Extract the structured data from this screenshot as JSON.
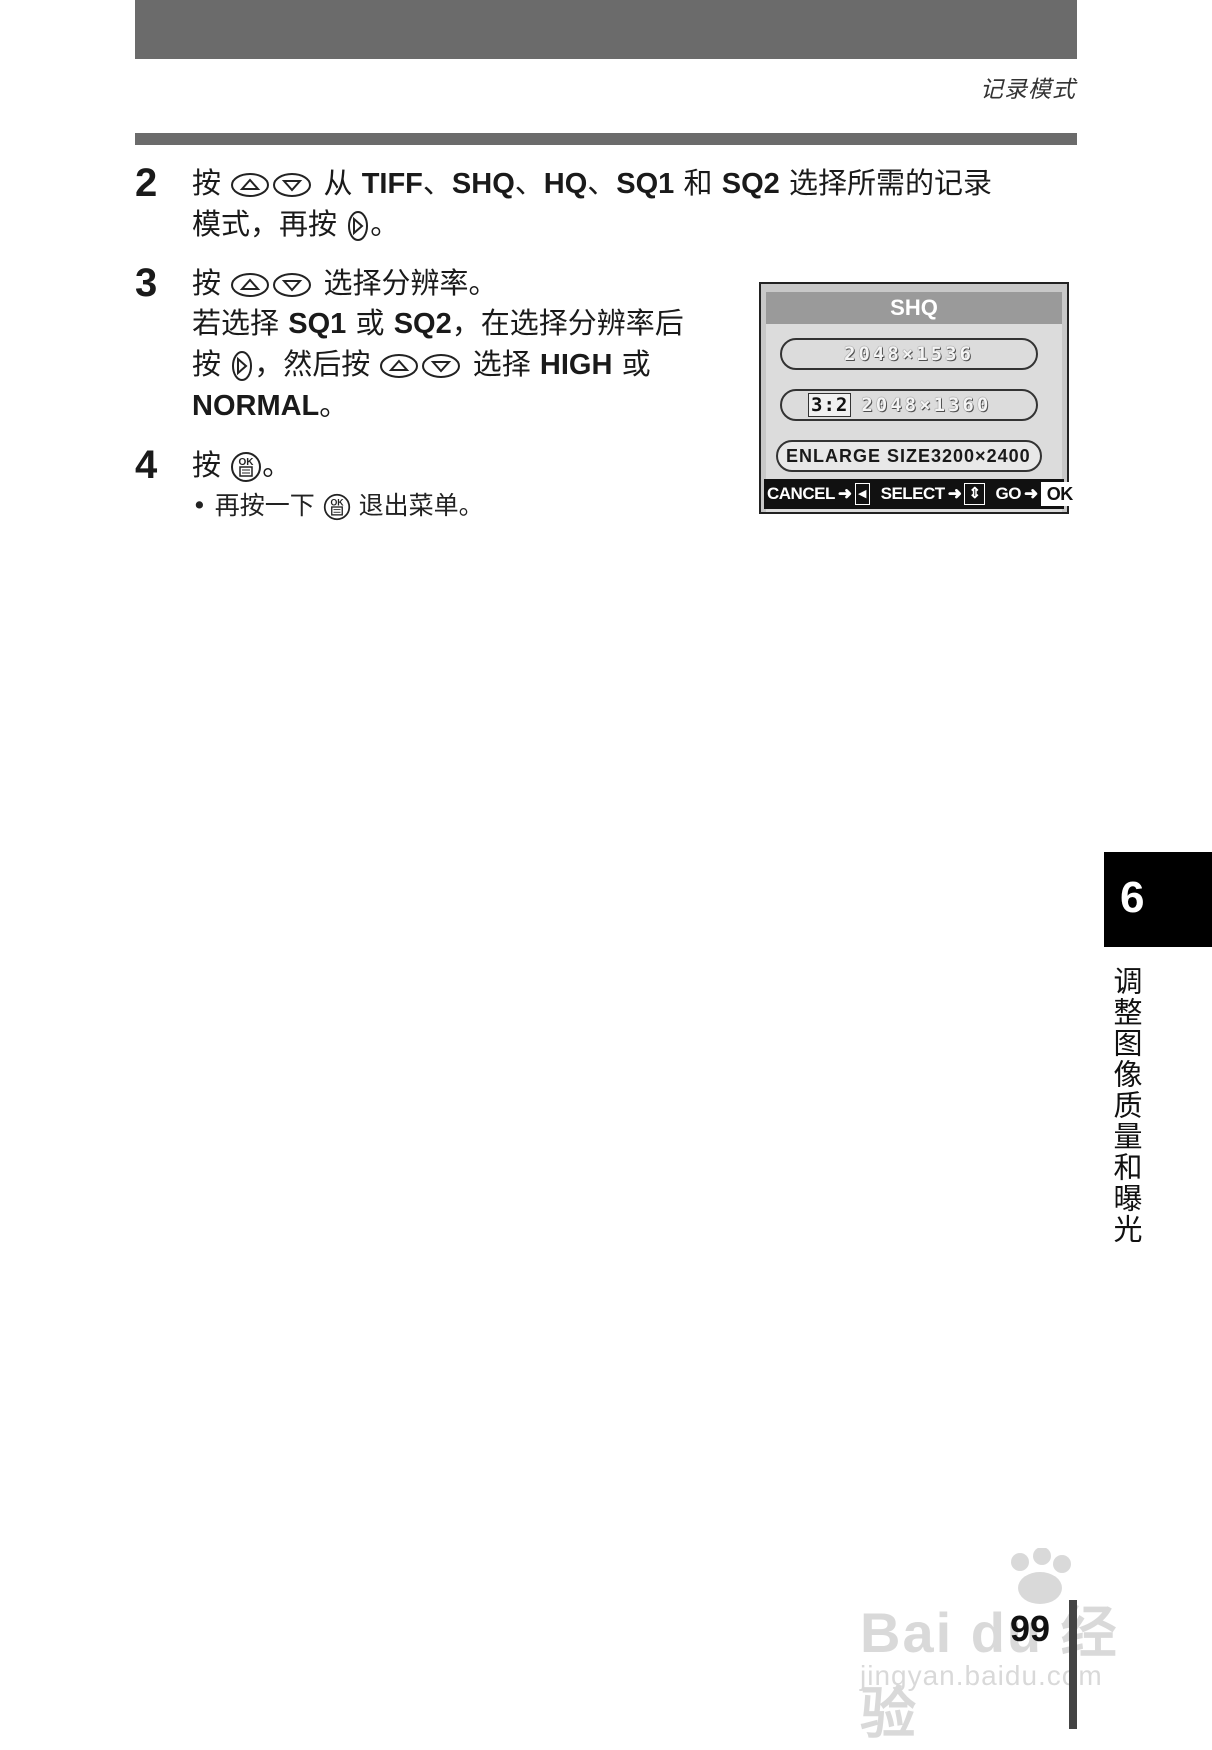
{
  "header": {
    "section_title": "记录模式"
  },
  "steps": [
    {
      "num": "2",
      "seg": [
        "按",
        "从",
        "TIFF",
        "、",
        "SHQ",
        "、",
        "HQ",
        "、",
        "SQ1",
        "和",
        "SQ2",
        "选择所需的记录",
        "模式，再按",
        "。"
      ]
    },
    {
      "num": "3",
      "seg": [
        "按",
        "选择分辨率。",
        "若选择",
        "SQ1",
        "或",
        "SQ2",
        "，在选择分辨率后",
        "按",
        "，然后按",
        "选择",
        "HIGH",
        "或",
        "NORMAL",
        "。"
      ]
    },
    {
      "num": "4",
      "seg": [
        "按",
        "。"
      ],
      "bullet": [
        "• 再按一下",
        "退出菜单。"
      ]
    }
  ],
  "lcd": {
    "title": "SHQ",
    "rows": [
      "2048×1536",
      "2048×1360",
      "ENLARGE SIZE3200×2400"
    ],
    "ratio_tag": "3:2",
    "footer": {
      "cancel": "CANCEL",
      "select": "SELECT",
      "go": "GO",
      "ok": "OK"
    }
  },
  "chapter": {
    "number": "6",
    "title": "调整图像质量和曝光"
  },
  "page_number": "99",
  "watermark": {
    "brand": "Bai du 经验",
    "url": "jingyan.baidu.com"
  },
  "icons": [
    "arrow-up-down-buttons-icon",
    "arrow-right-button-icon",
    "ok-menu-button-icon",
    "triangle-left-icon",
    "arrow-updown-small-icon",
    "paw-icon"
  ]
}
